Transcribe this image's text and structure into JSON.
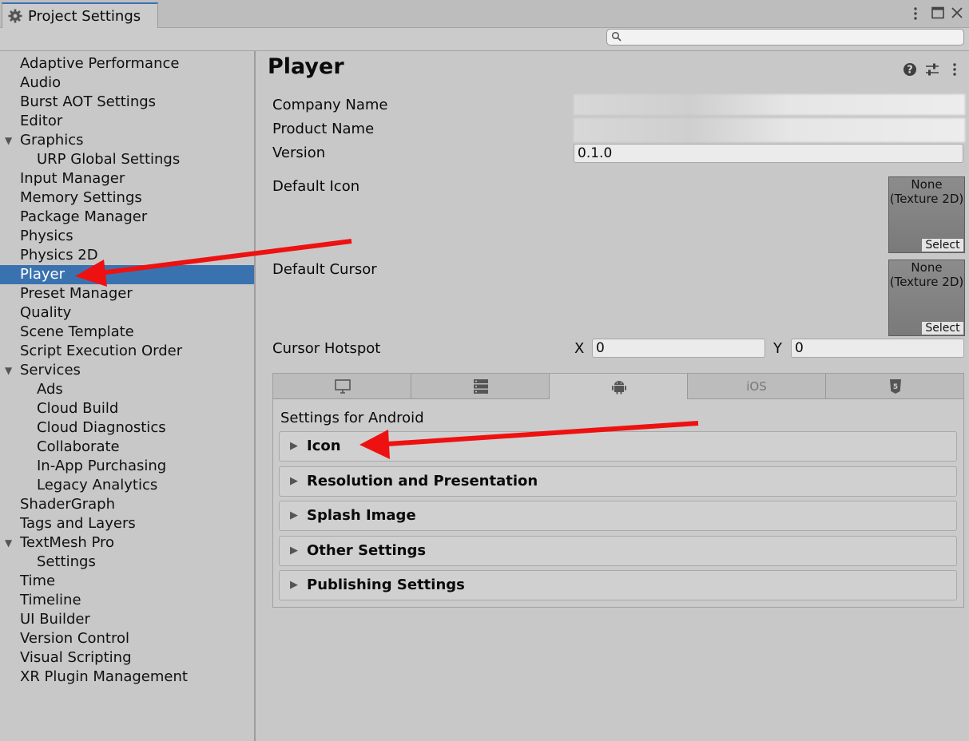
{
  "window": {
    "tab_title": "Project Settings",
    "tab_icon": "gear-icon",
    "controls": [
      "more-vertical-icon",
      "maximize-icon",
      "close-icon"
    ]
  },
  "search": {
    "placeholder": "",
    "value": ""
  },
  "sidebar": {
    "items": [
      {
        "label": "Adaptive Performance",
        "indent": 0,
        "foldout": false
      },
      {
        "label": "Audio",
        "indent": 0,
        "foldout": false
      },
      {
        "label": "Burst AOT Settings",
        "indent": 0,
        "foldout": false
      },
      {
        "label": "Editor",
        "indent": 0,
        "foldout": false
      },
      {
        "label": "Graphics",
        "indent": 0,
        "foldout": true
      },
      {
        "label": "URP Global Settings",
        "indent": 1,
        "foldout": false
      },
      {
        "label": "Input Manager",
        "indent": 0,
        "foldout": false
      },
      {
        "label": "Memory Settings",
        "indent": 0,
        "foldout": false
      },
      {
        "label": "Package Manager",
        "indent": 0,
        "foldout": false
      },
      {
        "label": "Physics",
        "indent": 0,
        "foldout": false
      },
      {
        "label": "Physics 2D",
        "indent": 0,
        "foldout": false
      },
      {
        "label": "Player",
        "indent": 0,
        "foldout": false,
        "selected": true
      },
      {
        "label": "Preset Manager",
        "indent": 0,
        "foldout": false
      },
      {
        "label": "Quality",
        "indent": 0,
        "foldout": false
      },
      {
        "label": "Scene Template",
        "indent": 0,
        "foldout": false
      },
      {
        "label": "Script Execution Order",
        "indent": 0,
        "foldout": false
      },
      {
        "label": "Services",
        "indent": 0,
        "foldout": true
      },
      {
        "label": "Ads",
        "indent": 1,
        "foldout": false
      },
      {
        "label": "Cloud Build",
        "indent": 1,
        "foldout": false
      },
      {
        "label": "Cloud Diagnostics",
        "indent": 1,
        "foldout": false
      },
      {
        "label": "Collaborate",
        "indent": 1,
        "foldout": false
      },
      {
        "label": "In-App Purchasing",
        "indent": 1,
        "foldout": false
      },
      {
        "label": "Legacy Analytics",
        "indent": 1,
        "foldout": false
      },
      {
        "label": "ShaderGraph",
        "indent": 0,
        "foldout": false
      },
      {
        "label": "Tags and Layers",
        "indent": 0,
        "foldout": false
      },
      {
        "label": "TextMesh Pro",
        "indent": 0,
        "foldout": true
      },
      {
        "label": "Settings",
        "indent": 1,
        "foldout": false
      },
      {
        "label": "Time",
        "indent": 0,
        "foldout": false
      },
      {
        "label": "Timeline",
        "indent": 0,
        "foldout": false
      },
      {
        "label": "UI Builder",
        "indent": 0,
        "foldout": false
      },
      {
        "label": "Version Control",
        "indent": 0,
        "foldout": false
      },
      {
        "label": "Visual Scripting",
        "indent": 0,
        "foldout": false
      },
      {
        "label": "XR Plugin Management",
        "indent": 0,
        "foldout": false
      }
    ]
  },
  "main": {
    "title": "Player",
    "header_icons": [
      "help-icon",
      "preset-sliders-icon",
      "more-vertical-icon"
    ],
    "company_name_label": "Company Name",
    "product_name_label": "Product Name",
    "version_label": "Version",
    "version_value": "0.1.0",
    "default_icon_label": "Default Icon",
    "default_cursor_label": "Default Cursor",
    "texture_none_line1": "None",
    "texture_none_line2": "(Texture 2D)",
    "select_label": "Select",
    "cursor_hotspot_label": "Cursor Hotspot",
    "hotspot_x_label": "X",
    "hotspot_x_value": "0",
    "hotspot_y_label": "Y",
    "hotspot_y_value": "0"
  },
  "platform_tabs": [
    {
      "icon": "desktop-monitor-icon"
    },
    {
      "icon": "server-icon"
    },
    {
      "icon": "android-icon",
      "active": true
    },
    {
      "label": "iOS"
    },
    {
      "icon": "html5-icon"
    }
  ],
  "platform_settings": {
    "heading": "Settings for Android",
    "sections": [
      "Icon",
      "Resolution and Presentation",
      "Splash Image",
      "Other Settings",
      "Publishing Settings"
    ]
  },
  "colors": {
    "selection": "#3a72b0",
    "annotation_arrow": "#ee1111",
    "panel_bg": "#c8c8c8"
  }
}
